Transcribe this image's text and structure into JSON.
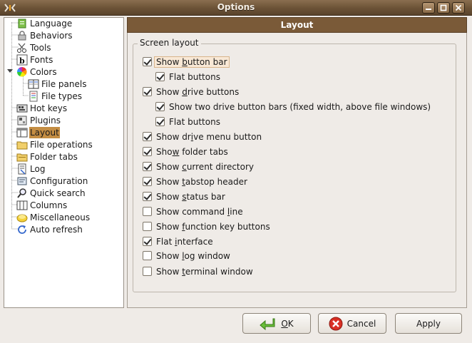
{
  "window": {
    "title": "Options"
  },
  "tree": {
    "items": [
      {
        "label": "Language",
        "icon": "language-icon"
      },
      {
        "label": "Behaviors",
        "icon": "lock-icon"
      },
      {
        "label": "Tools",
        "icon": "scissors-icon"
      },
      {
        "label": "Fonts",
        "icon": "font-icon"
      },
      {
        "label": "Colors",
        "icon": "color-wheel-icon"
      },
      {
        "label": "File panels",
        "icon": "panels-icon"
      },
      {
        "label": "File types",
        "icon": "file-types-icon"
      },
      {
        "label": "Hot keys",
        "icon": "hotkeys-icon"
      },
      {
        "label": "Plugins",
        "icon": "plugins-icon"
      },
      {
        "label": "Layout",
        "icon": "layout-icon"
      },
      {
        "label": "File operations",
        "icon": "folder-icon"
      },
      {
        "label": "Folder tabs",
        "icon": "folder-tabs-icon"
      },
      {
        "label": "Log",
        "icon": "log-icon"
      },
      {
        "label": "Configuration",
        "icon": "configuration-icon"
      },
      {
        "label": "Quick search",
        "icon": "quick-search-icon"
      },
      {
        "label": "Columns",
        "icon": "columns-icon"
      },
      {
        "label": "Miscellaneous",
        "icon": "miscellaneous-icon"
      },
      {
        "label": "Auto refresh",
        "icon": "refresh-icon"
      }
    ],
    "selected": "Layout"
  },
  "content": {
    "header": "Layout",
    "group_title": "Screen layout",
    "options": [
      {
        "pre": "Show ",
        "mn": "b",
        "post": "utton bar",
        "checked": true
      },
      {
        "pre": "Flat buttons",
        "mn": "",
        "post": "",
        "checked": true
      },
      {
        "pre": "Show ",
        "mn": "d",
        "post": "rive buttons",
        "checked": true
      },
      {
        "pre": "Show two drive button bars (fixed width, above file windows)",
        "mn": "",
        "post": "",
        "checked": true
      },
      {
        "pre": "Flat buttons",
        "mn": "",
        "post": "",
        "checked": true
      },
      {
        "pre": "Show dr",
        "mn": "i",
        "post": "ve menu button",
        "checked": true
      },
      {
        "pre": "Sho",
        "mn": "w",
        "post": " folder tabs",
        "checked": true
      },
      {
        "pre": "Show ",
        "mn": "c",
        "post": "urrent directory",
        "checked": true
      },
      {
        "pre": "Show ",
        "mn": "t",
        "post": "abstop header",
        "checked": true
      },
      {
        "pre": "Show ",
        "mn": "s",
        "post": "tatus bar",
        "checked": true
      },
      {
        "pre": "Show command ",
        "mn": "l",
        "post": "ine",
        "checked": false
      },
      {
        "pre": "Show ",
        "mn": "f",
        "post": "unction key buttons",
        "checked": false
      },
      {
        "pre": "Flat ",
        "mn": "i",
        "post": "nterface",
        "checked": true
      },
      {
        "pre": "Show ",
        "mn": "l",
        "post": "og window",
        "checked": false
      },
      {
        "pre": "Show ",
        "mn": "t",
        "post": "erminal window",
        "checked": false
      }
    ]
  },
  "buttons": {
    "ok": {
      "mn": "O",
      "rest": "K"
    },
    "cancel": "Cancel",
    "apply": "Apply"
  },
  "colors": {
    "accent": "#7a5a38",
    "selection": "#c48d43"
  }
}
